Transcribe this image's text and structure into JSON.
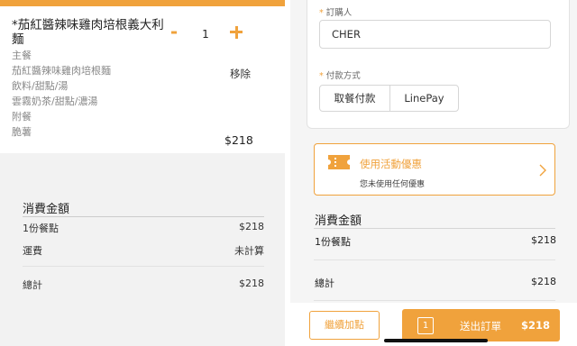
{
  "cart": {
    "item_name": "*茄紅醬辣味雞肉培根義大利麵",
    "quantity": "1",
    "minus_symbol": "-",
    "options": [
      "主餐",
      "茄紅醬辣味雞肉培根麵",
      "飲料/甜點/湯",
      "雲霧奶茶/甜點/濃湯",
      "附餐",
      "脆薯"
    ],
    "remove_label": "移除",
    "item_price": "$218"
  },
  "summary_left": {
    "title": "消費金額",
    "rows": [
      {
        "label": "1份餐點",
        "value": "$218"
      },
      {
        "label": "運費",
        "value": "未計算"
      },
      {
        "label": "總計",
        "value": "$218"
      }
    ]
  },
  "order_form": {
    "buyer_label": "訂購人",
    "buyer_value": "CHER",
    "payment_label": "付款方式",
    "payment_options": [
      "取餐付款",
      "LinePay"
    ],
    "required_mark": "*"
  },
  "promo": {
    "title": "使用活動優惠",
    "subtitle": "您未使用任何優惠",
    "icon": "ticket-icon"
  },
  "summary_right": {
    "title": "消費金額",
    "rows": [
      {
        "label": "1份餐點",
        "value": "$218"
      },
      {
        "label": "總計",
        "value": "$218"
      }
    ]
  },
  "bottom_bar": {
    "continue_label": "繼續加點",
    "count": "1",
    "submit_label": "送出訂單",
    "total": "$218"
  },
  "colors": {
    "accent": "#f0a23c",
    "background": "#f2f2f2"
  }
}
